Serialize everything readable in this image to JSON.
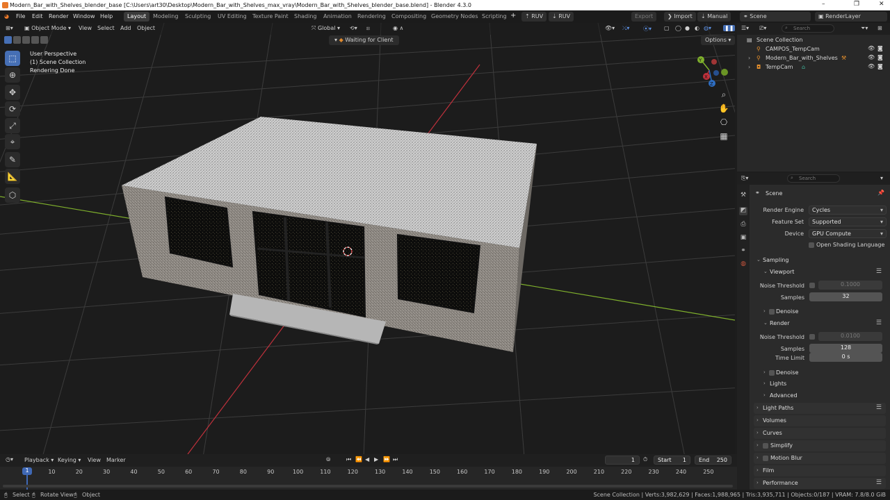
{
  "window": {
    "title": "Modern_Bar_with_Shelves_blender_base [C:\\Users\\art30\\Desktop\\Modern_Bar_with_Shelves_max_vray\\Modern_Bar_with_Shelves_blender_base.blend] - Blender 4.3.0",
    "minimize": "–",
    "maximize": "❐",
    "close": "✕"
  },
  "menu": {
    "file": "File",
    "edit": "Edit",
    "render": "Render",
    "window": "Window",
    "help": "Help"
  },
  "workspaces": [
    "Layout",
    "Modeling",
    "Sculpting",
    "UV Editing",
    "Texture Paint",
    "Shading",
    "Animation",
    "Rendering",
    "Compositing",
    "Geometry Nodes",
    "Scripting"
  ],
  "addons": {
    "ruv1": "RUV",
    "ruv2": "RUV",
    "export": "Export",
    "import": "Import",
    "manual": "Manual"
  },
  "scene_selector": "Scene",
  "view_layer": "RenderLayer",
  "viewport": {
    "mode": "Object Mode",
    "menus": [
      "View",
      "Select",
      "Add",
      "Object"
    ],
    "orientation": "Global",
    "status_pill": "Waiting for Client",
    "options": "Options",
    "overlay": {
      "perspective": "User Perspective",
      "collection": "(1) Scene Collection",
      "render": "Rendering Done"
    },
    "gizmo": {
      "x": "X",
      "y": "Y",
      "z": "Z"
    }
  },
  "outliner": {
    "search_placeholder": "Search",
    "root": "Scene Collection",
    "items": [
      {
        "name": "CAMPOS_TempCam"
      },
      {
        "name": "Modern_Bar_with_Shelves"
      },
      {
        "name": "TempCam"
      }
    ]
  },
  "properties": {
    "search_placeholder": "Search",
    "context": "Scene",
    "render_engine_label": "Render Engine",
    "render_engine": "Cycles",
    "feature_set_label": "Feature Set",
    "feature_set": "Supported",
    "device_label": "Device",
    "device": "GPU Compute",
    "osl_label": "Open Shading Language",
    "sampling": "Sampling",
    "viewport_sub": "Viewport",
    "noise_threshold_label": "Noise Threshold",
    "vp_noise_threshold": "0.1000",
    "samples_label": "Samples",
    "vp_samples": "32",
    "denoise_label": "Denoise",
    "render_sub": "Render",
    "r_noise_threshold": "0.0100",
    "r_samples": "128",
    "time_limit_label": "Time Limit",
    "time_limit": "0 s",
    "lights": "Lights",
    "advanced": "Advanced",
    "sections": [
      "Light Paths",
      "Volumes",
      "Curves",
      "Simplify",
      "Motion Blur",
      "Film",
      "Performance"
    ]
  },
  "timeline": {
    "menus": [
      "Playback",
      "Keying",
      "View",
      "Marker"
    ],
    "current_frame": "1",
    "start_label": "Start",
    "start": "1",
    "end_label": "End",
    "end": "250",
    "playhead": "1",
    "ticks": [
      "10",
      "20",
      "30",
      "40",
      "50",
      "60",
      "70",
      "80",
      "90",
      "100",
      "110",
      "120",
      "130",
      "140",
      "150",
      "160",
      "170",
      "180",
      "190",
      "200",
      "210",
      "220",
      "230",
      "240",
      "250"
    ]
  },
  "status": {
    "select": "Select",
    "rotate": "Rotate View",
    "object": "Object",
    "info": "Scene Collection | Verts:3,982,629 | Faces:1,988,965 | Tris:3,935,711 | Objects:0/187 | VRAM: 7.8/8.0 GiB"
  },
  "colors": {
    "accent": "#466fb5",
    "x_axis": "#c0313c",
    "y_axis": "#7fb02c",
    "z_axis": "#2f6fc4"
  }
}
